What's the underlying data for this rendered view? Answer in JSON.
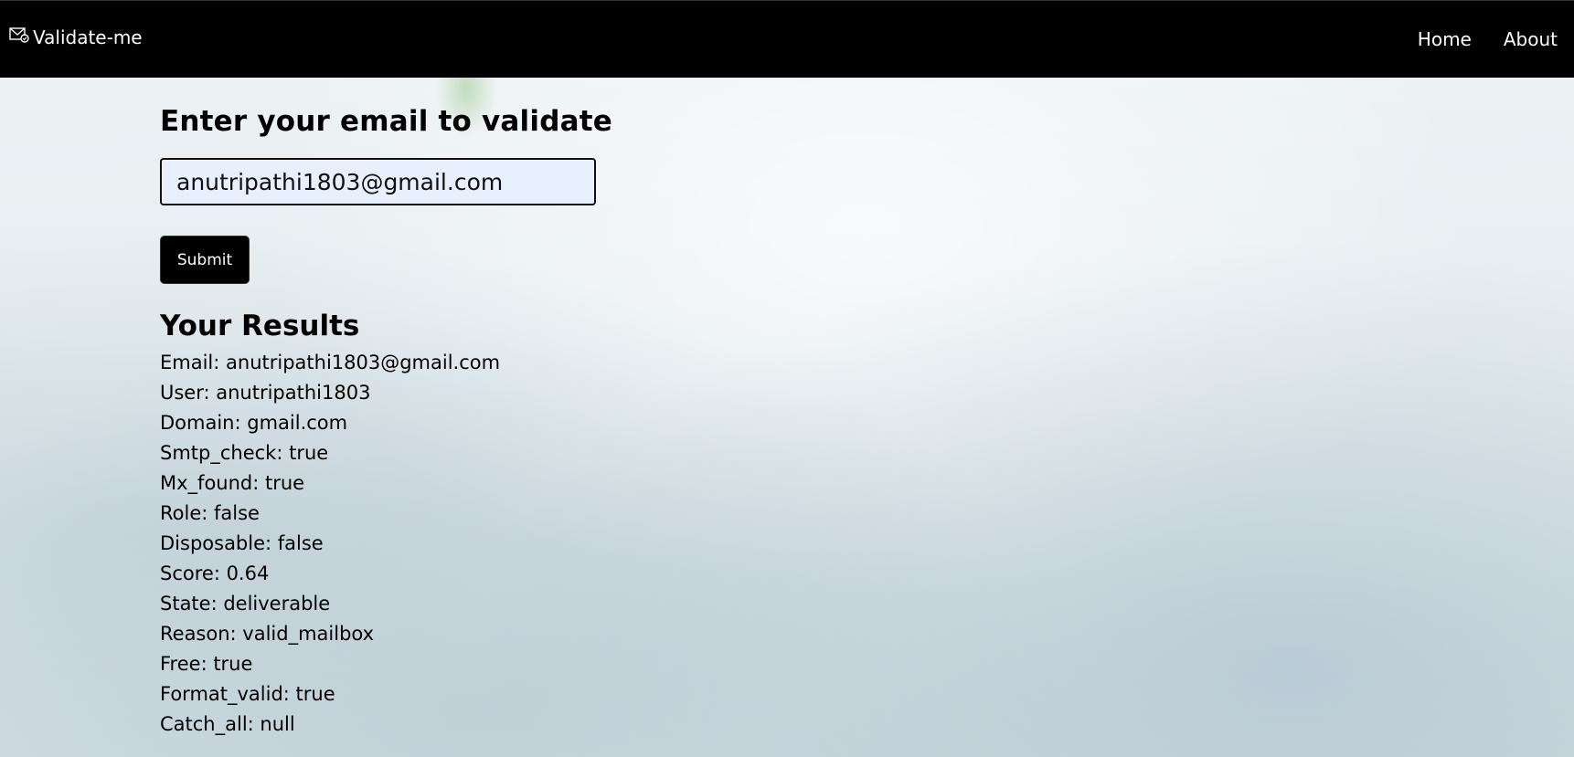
{
  "navbar": {
    "brand_label": "Validate-me",
    "brand_icon": "envelope-icon",
    "links": [
      {
        "label": "Home"
      },
      {
        "label": "About"
      }
    ]
  },
  "form": {
    "heading": "Enter your email to validate",
    "email_value": "anutripathi1803@gmail.com",
    "submit_label": "Submit"
  },
  "results": {
    "heading": "Your Results",
    "items": [
      "Email: anutripathi1803@gmail.com",
      "User: anutripathi1803",
      "Domain: gmail.com",
      "Smtp_check: true",
      "Mx_found: true",
      "Role: false",
      "Disposable: false",
      "Score: 0.64",
      "State: deliverable",
      "Reason: valid_mailbox",
      "Free: true",
      "Format_valid: true",
      "Catch_all: null"
    ]
  },
  "colors": {
    "navbar_bg": "#000000",
    "input_bg": "#e8effd",
    "button_bg": "#000000"
  }
}
